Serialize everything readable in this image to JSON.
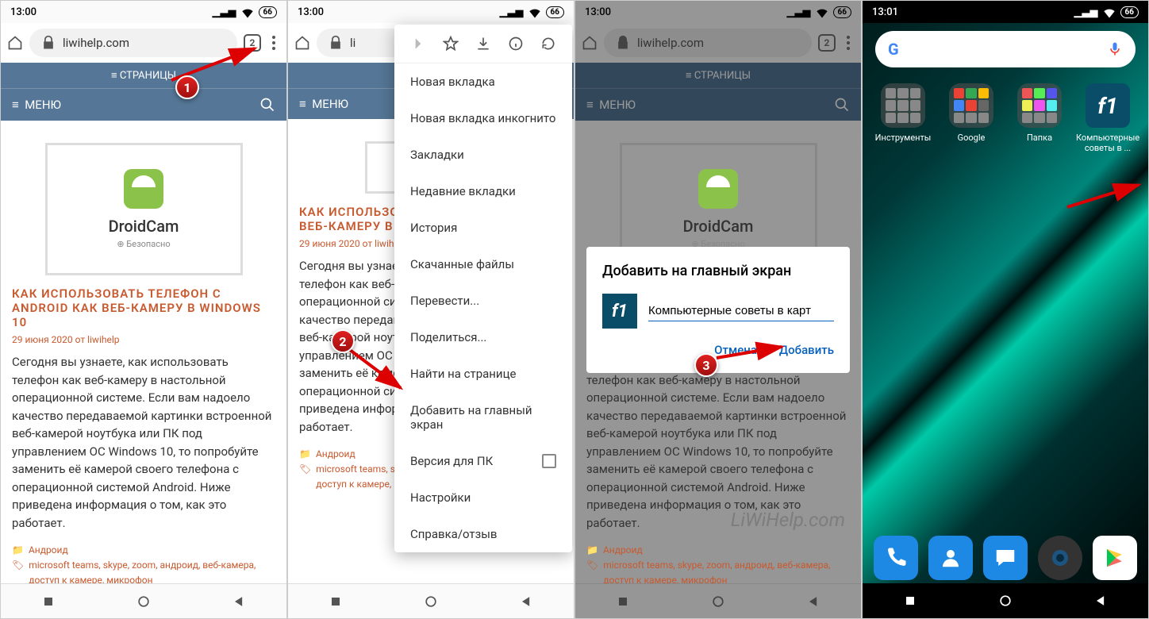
{
  "status": {
    "time": "13:00",
    "time_alt": "13:01",
    "battery": "66",
    "signal": "▁▃▅",
    "wifi": "⋮"
  },
  "url_bar": {
    "domain": "liwihelp.com",
    "tabs": "2"
  },
  "site": {
    "pages": "≡  СТРАНИЦЫ",
    "menu": "МЕНЮ",
    "droidcam": "DroidCam",
    "safe": "Безопасно"
  },
  "article": {
    "title": "КАК ИСПОЛЬЗОВАТЬ ТЕЛЕФОН С ANDROID КАК ВЕБ-КАМЕРУ В WINDOWS 10",
    "meta": "29 июня 2020 от liwihelp",
    "text": "Сегодня вы узнаете, как использовать телефон как веб-камеру в настольной операционной системе. Если вам надоело качество передаваемой картинки встроенной веб-камерой ноутбука или ПК под управлением ОС Windows 10, то попробуйте заменить её камерой своего телефона с операционной системой Android. Ниже приведена информация о том, как это работает.",
    "category": "Андроид",
    "tags": "microsoft teams, skype, zoom, андроид, веб-камера, доступ к камере, микрофон"
  },
  "dropdown": {
    "new_tab": "Новая вкладка",
    "incognito": "Новая вкладка инкогнито",
    "bookmarks": "Закладки",
    "recent": "Недавние вкладки",
    "history": "История",
    "downloads": "Скачанные файлы",
    "translate": "Перевести...",
    "share": "Поделиться...",
    "find": "Найти на странице",
    "add_home": "Добавить на главный экран",
    "desktop": "Версия для ПК",
    "settings": "Настройки",
    "help": "Справка/отзыв"
  },
  "dialog": {
    "title": "Добавить на главный экран",
    "input": "Компьютерные советы в карт",
    "cancel": "Отмена",
    "add": "Добавить"
  },
  "home": {
    "folder1": "Инструменты",
    "folder2": "Google",
    "folder3": "Папка",
    "app": "Компьютерные советы в ..."
  },
  "watermark": "LiWiHelp.com"
}
